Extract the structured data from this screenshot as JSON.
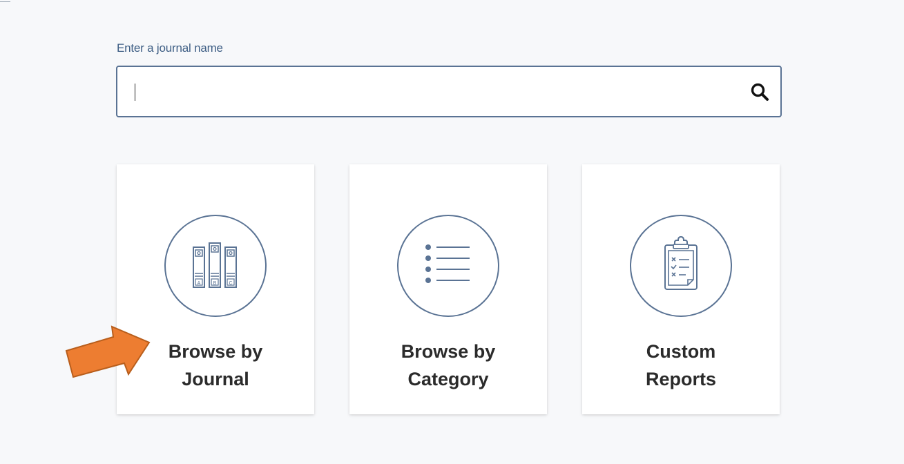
{
  "search": {
    "label": "Enter a journal name",
    "placeholder": "",
    "value": ""
  },
  "cards": [
    {
      "line1": "Browse by",
      "line2": "Journal",
      "icon": "binders-icon"
    },
    {
      "line1": "Browse by",
      "line2": "Category",
      "icon": "list-icon"
    },
    {
      "line1": "Custom",
      "line2": "Reports",
      "icon": "clipboard-icon"
    }
  ],
  "binder_letters": [
    "A",
    "B",
    "C"
  ],
  "colors": {
    "icon_stroke": "#5a7394",
    "label_text": "#3f5f85",
    "arrow_fill": "#ed7d31",
    "arrow_stroke": "#b85e1c"
  }
}
